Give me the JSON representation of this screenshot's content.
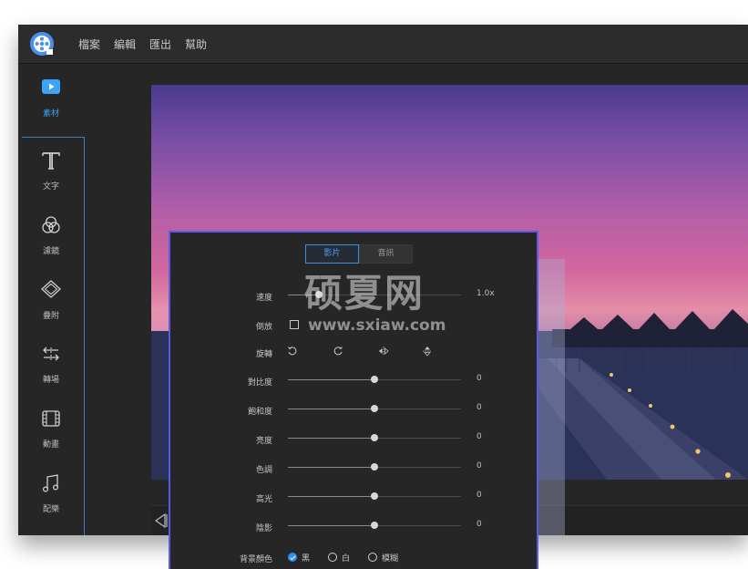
{
  "menu": {
    "items": [
      "檔案",
      "編輯",
      "匯出",
      "幫助"
    ]
  },
  "sidebar": {
    "items": [
      {
        "label": "素材",
        "icon": "media-icon",
        "active": true
      },
      {
        "label": "文字",
        "icon": "text-icon"
      },
      {
        "label": "濾鏡",
        "icon": "filter-icon"
      },
      {
        "label": "疊附",
        "icon": "overlay-icon"
      },
      {
        "label": "轉場",
        "icon": "transition-icon"
      },
      {
        "label": "動畫",
        "icon": "animation-icon"
      },
      {
        "label": "配樂",
        "icon": "music-icon"
      }
    ]
  },
  "panel": {
    "tabs": {
      "video": "影片",
      "audio": "音訊"
    },
    "speed": {
      "label": "速度",
      "value": "1.0x",
      "level": 0.18
    },
    "reverse": {
      "label": "倒放"
    },
    "rotate": {
      "label": "旋轉"
    },
    "adjustments": [
      {
        "label": "對比度",
        "value": "0",
        "level": 0.5
      },
      {
        "label": "飽和度",
        "value": "0",
        "level": 0.5
      },
      {
        "label": "亮度",
        "value": "0",
        "level": 0.5
      },
      {
        "label": "色調",
        "value": "0",
        "level": 0.5
      },
      {
        "label": "高光",
        "value": "0",
        "level": 0.5
      },
      {
        "label": "陰影",
        "value": "0",
        "level": 0.5
      }
    ],
    "background_color": {
      "label": "背景顏色",
      "options": [
        "黑",
        "白",
        "模糊"
      ],
      "selected": "黑"
    }
  },
  "watermark": {
    "title": "硕夏网",
    "url": "www.sxiaw.com"
  },
  "colors": {
    "accent": "#2f8ef0",
    "panel_border": "#5a5ae6",
    "active_label": "#3da3f5"
  }
}
